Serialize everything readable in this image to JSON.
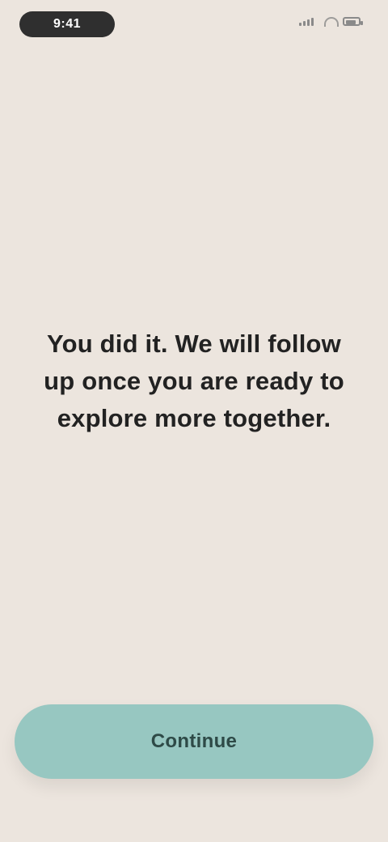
{
  "status_bar": {
    "pill_text": "9:41",
    "right_label": "",
    "battery_level": 0.85
  },
  "main": {
    "message": "You did it. We will follow up once you are ready to explore more together."
  },
  "primary_button": {
    "label": "Continue"
  }
}
